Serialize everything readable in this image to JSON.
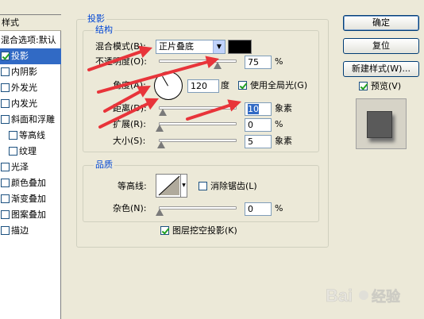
{
  "sidebar": {
    "header": "样式",
    "items": [
      {
        "label": "混合选项:默认",
        "checkbox": false,
        "checked": false
      },
      {
        "label": "投影",
        "checkbox": true,
        "checked": true,
        "selected": true
      },
      {
        "label": "内阴影",
        "checkbox": true,
        "checked": false
      },
      {
        "label": "外发光",
        "checkbox": true,
        "checked": false
      },
      {
        "label": "内发光",
        "checkbox": true,
        "checked": false
      },
      {
        "label": "斜面和浮雕",
        "checkbox": true,
        "checked": false
      },
      {
        "label": "等高线",
        "checkbox": true,
        "checked": false
      },
      {
        "label": "纹理",
        "checkbox": true,
        "checked": false
      },
      {
        "label": "光泽",
        "checkbox": true,
        "checked": false
      },
      {
        "label": "颜色叠加",
        "checkbox": true,
        "checked": false
      },
      {
        "label": "渐变叠加",
        "checkbox": true,
        "checked": false
      },
      {
        "label": "图案叠加",
        "checkbox": true,
        "checked": false
      },
      {
        "label": "描边",
        "checkbox": true,
        "checked": false
      }
    ]
  },
  "panel": {
    "title": "投影",
    "structure": {
      "title": "结构",
      "blend_mode_label": "混合模式(B):",
      "blend_mode_value": "正片叠底",
      "blend_color": "#000000",
      "opacity_label": "不透明度(O):",
      "opacity_value": "75",
      "opacity_unit": "%",
      "opacity_level": 0.75,
      "angle_label": "角度(A):",
      "angle_value": "120",
      "angle_unit": "度",
      "global_light_label": "使用全局光(G)",
      "global_light_checked": true,
      "distance_label": "距离(D):",
      "distance_value": "10",
      "distance_unit": "象素",
      "spread_label": "扩展(R):",
      "spread_value": "0",
      "spread_unit": "%",
      "size_label": "大小(S):",
      "size_value": "5",
      "size_unit": "象素"
    },
    "quality": {
      "title": "品质",
      "contour_label": "等高线:",
      "anti_alias_label": "消除锯齿(L)",
      "anti_alias_checked": false,
      "noise_label": "杂色(N):",
      "noise_value": "0",
      "noise_unit": "%"
    },
    "knockout_label": "图层挖空投影(K)",
    "knockout_checked": true
  },
  "buttons": {
    "ok": "确定",
    "reset": "复位",
    "new_style": "新建样式(W)...",
    "preview_label": "预览(V)",
    "preview_checked": true
  },
  "annotation_color": "#e8343a"
}
